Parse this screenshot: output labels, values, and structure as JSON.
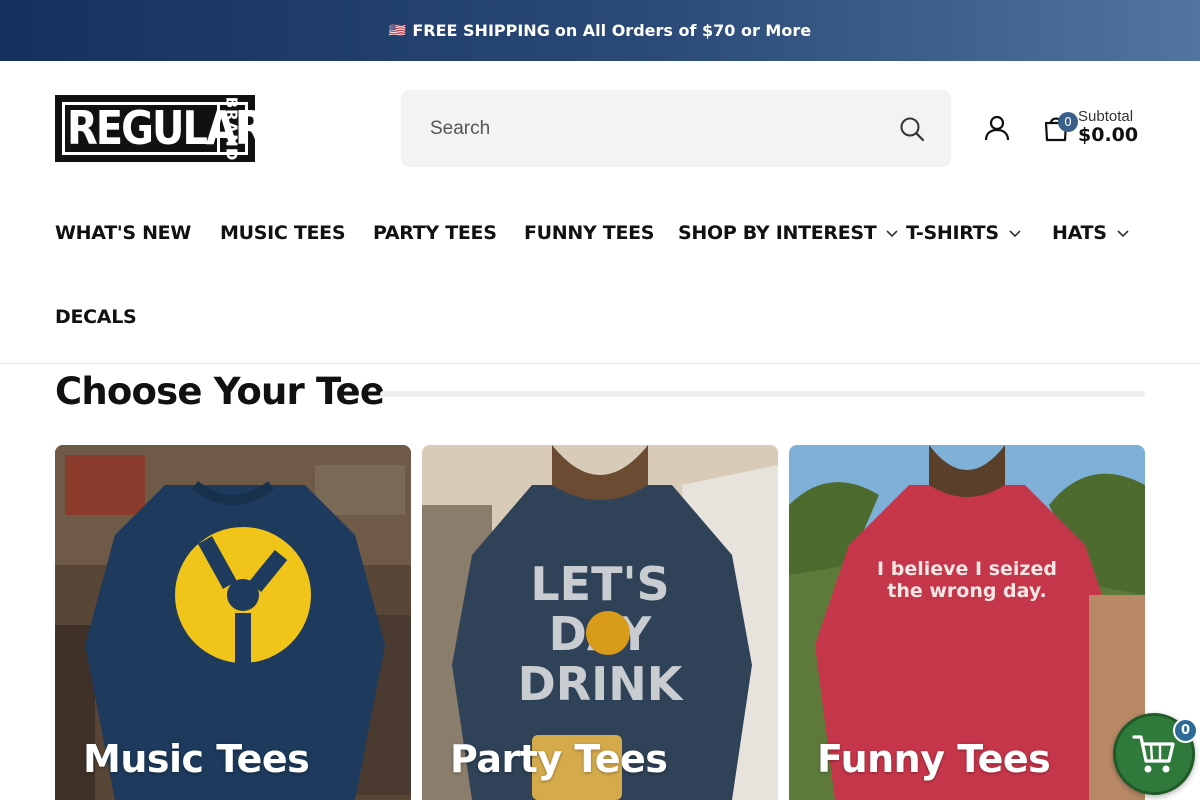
{
  "announcement": {
    "flag": "🇺🇸",
    "strong": "FREE SHIPPING",
    "rest": "on All Orders of $70 or More"
  },
  "logo": {
    "word": "REGULAR",
    "vertical": "BRAND"
  },
  "search": {
    "placeholder": "Search",
    "icon": "search-icon"
  },
  "header": {
    "account_icon": "user-icon",
    "cart_icon": "bag-icon",
    "cart_count": "0",
    "subtotal_label": "Subtotal",
    "subtotal_value": "$0.00"
  },
  "nav": {
    "items": [
      {
        "label": "WHAT'S NEW",
        "dropdown": false
      },
      {
        "label": "MUSIC TEES",
        "dropdown": false
      },
      {
        "label": "PARTY TEES",
        "dropdown": false
      },
      {
        "label": "FUNNY TEES",
        "dropdown": false
      },
      {
        "label": "SHOP BY INTEREST",
        "dropdown": true
      },
      {
        "label": "T-SHIRTS",
        "dropdown": true
      },
      {
        "label": "HATS",
        "dropdown": true
      },
      {
        "label": "DECALS",
        "dropdown": false
      }
    ]
  },
  "section": {
    "title": "Choose Your Tee"
  },
  "cards": [
    {
      "label": "Music Tees",
      "shirt_color": "#1e3a5c"
    },
    {
      "label": "Party Tees",
      "shirt_color": "#2f4258",
      "shirt_text": [
        "LET'S",
        "DAY",
        "DRINK"
      ]
    },
    {
      "label": "Funny Tees",
      "shirt_color": "#c6364a",
      "shirt_text": [
        "I believe I seized",
        "the wrong day."
      ]
    }
  ],
  "floating_cart": {
    "count": "0",
    "icon": "cart-icon",
    "color": "#2f7a3a"
  }
}
